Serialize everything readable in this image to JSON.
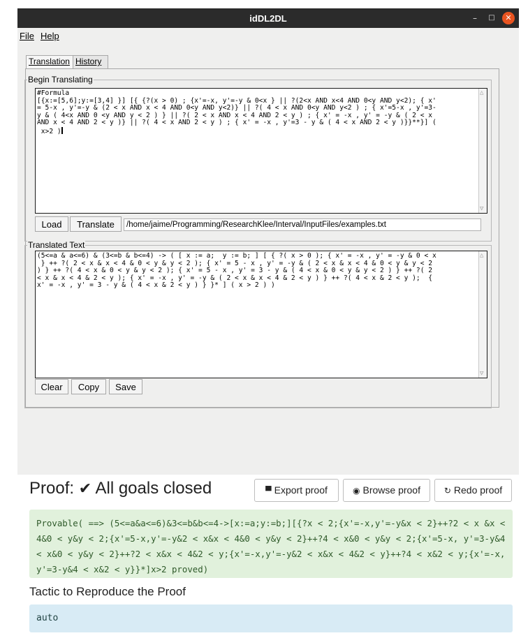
{
  "window": {
    "title": "idDL2DL",
    "controls": {
      "minimize": "–",
      "maximize": "□",
      "close": "✕"
    }
  },
  "menu": {
    "file": "File",
    "help": "Help"
  },
  "tabs": [
    {
      "label": "Translation",
      "active": true
    },
    {
      "label": "History",
      "active": false
    }
  ],
  "begin": {
    "legend": "Begin Translating",
    "lines": [
      "#Formula",
      "[{x:=[5,6];y:=[3,4] }] [{ {?(x > 0) ; {x'=-x, y'=-y & 0<x } || ?(2<x AND x<4 AND 0<y AND y<2); { x'",
      "= 5-x , y'=-y & (2 < x AND x < 4 AND 0<y AND y<2)} || ?( 4 < x AND 0<y AND y<2 ) ; { x'=5-x , y'=3-",
      "y & ( 4<x AND 0 <y AND y < 2 ) } || ?( 2 < x AND x < 4 AND 2 < y ) ; { x' = -x , y' = -y & ( 2 < x",
      "AND x < 4 AND 2 < y )} || ?( 4 < x AND 2 < y ) ; { x' = -x , y'=3 - y & ( 4 < x AND 2 < y )}}**}] (",
      " x>2 )"
    ],
    "load_label": "Load",
    "translate_label": "Translate",
    "path": "/home/jaime/Programming/ResearchKlee/Interval/InputFiles/examples.txt"
  },
  "translated": {
    "legend": "Translated Text",
    "lines": [
      "(5<=a & a<=6) & (3<=b & b<=4) -> ( [ x := a;  y := b; ] [ { ?( x > 0 ); { x' = -x , y' = -y & 0 < x",
      " } ++ ?( 2 < x & x < 4 & 0 < y & y < 2 ); { x' = 5 - x , y' = -y & ( 2 < x & x < 4 & 0 < y & y < 2",
      ") } ++ ?( 4 < x & 0 < y & y < 2 ); { x' = 5 - x , y' = 3 - y & ( 4 < x & 0 < y & y < 2 ) } ++ ?( 2",
      "< x & x < 4 & 2 < y ); { x' = -x , y' = -y & ( 2 < x & x < 4 & 2 < y ) } ++ ?( 4 < x & 2 < y );  {",
      "x' = -x , y' = 3 - y & ( 4 < x & 2 < y ) } }* ] ( x > 2 ) )"
    ],
    "clear_label": "Clear",
    "copy_label": "Copy",
    "save_label": "Save"
  },
  "proof": {
    "title": "Proof:",
    "status": "All goals closed",
    "check_icon": "check-icon",
    "export_label": "Export proof",
    "browse_label": "Browse proof",
    "redo_label": "Redo proof",
    "result": "Provable(  ==>  (5<=a&a<=6)&3<=b&b<=4->[x:=a;y:=b;][{?x < 2;{x'=-x,y'=-y&x < 2}++?2 < x &x < 4&0 < y&y < 2;{x'=5-x,y'=-y&2 < x&x < 4&0 < y&y < 2}++?4 < x&0 < y&y < 2;{x'=5-x, y'=3-y&4 < x&0 < y&y < 2}++?2 < x&x < 4&2 < y;{x'=-x,y'=-y&2 < x&x < 4&2 < y}++?4 < x&2 < y;{x'=-x,y'=3-y&4 < x&2 < y}}*]x>2 proved)",
    "tactic_title": "Tactic to Reproduce the Proof",
    "tactic": "auto"
  },
  "colors": {
    "titlebar": "#2b2b2b",
    "close_button": "#e95420",
    "result_bg": "#e1f1dc",
    "tactic_bg": "#d8ebf5"
  }
}
